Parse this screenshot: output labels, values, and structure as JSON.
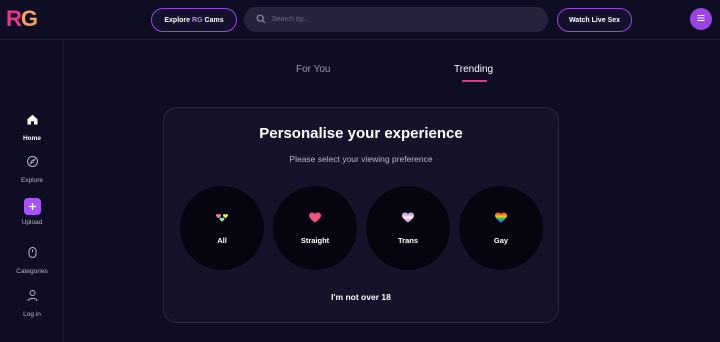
{
  "header": {
    "logo": {
      "r": "R",
      "g": "G"
    },
    "explore": {
      "before": "Explore",
      "accent": "RG",
      "after": "Cams"
    },
    "search_placeholder": "Search by...",
    "watch_live_label": "Watch Live Sex",
    "menu_icon": "menu-icon"
  },
  "sidebar": {
    "items": [
      {
        "label": "Home",
        "icon": "home-icon"
      },
      {
        "label": "Explore",
        "icon": "compass-icon"
      },
      {
        "label": "Upload",
        "icon": "plus-icon"
      },
      {
        "label": "Categories",
        "icon": "categories-icon"
      },
      {
        "label": "Log in",
        "icon": "user-icon"
      }
    ]
  },
  "tabs": [
    {
      "label": "For You"
    },
    {
      "label": "Trending"
    }
  ],
  "card": {
    "title": "Personalise your experience",
    "subtitle": "Please select your viewing preference",
    "options": [
      {
        "label": "All",
        "icon": "hearts-icon"
      },
      {
        "label": "Straight",
        "icon": "heart-icon"
      },
      {
        "label": "Trans",
        "icon": "trans-heart-icon"
      },
      {
        "label": "Gay",
        "icon": "rainbow-heart-icon"
      }
    ],
    "not_over_label": "I'm not over 18"
  },
  "colors": {
    "background": "#0f0d24",
    "accent_purple": "#9b45e0",
    "accent_pink": "#e8368f",
    "card_bg": "#14132a"
  }
}
